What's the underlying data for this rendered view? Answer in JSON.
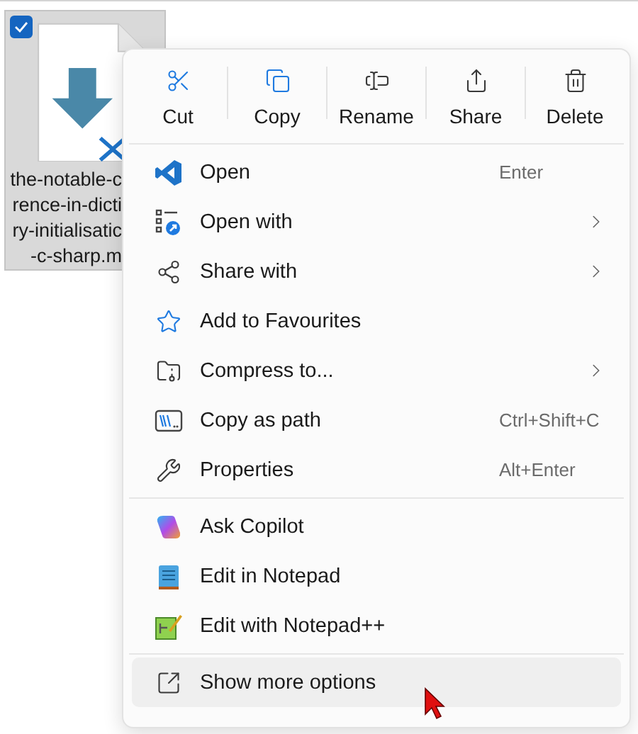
{
  "file": {
    "checked": true,
    "selected": true,
    "name_lines": [
      "the-notable-c",
      "rence-in-dicti",
      "ry-initialisatic",
      "-c-sharp.m"
    ]
  },
  "toolbar": [
    {
      "label": "Cut"
    },
    {
      "label": "Copy"
    },
    {
      "label": "Rename"
    },
    {
      "label": "Share"
    },
    {
      "label": "Delete"
    }
  ],
  "sections": [
    {
      "items": [
        {
          "label": "Open",
          "shortcut": "Enter",
          "submenu": false,
          "selected": false
        },
        {
          "label": "Open with",
          "submenu": true,
          "selected": false
        },
        {
          "label": "Share with",
          "submenu": true,
          "selected": false
        },
        {
          "label": "Add to Favourites",
          "submenu": false,
          "selected": false
        },
        {
          "label": "Compress to...",
          "submenu": true,
          "selected": false
        },
        {
          "label": "Copy as path",
          "shortcut": "Ctrl+Shift+C",
          "submenu": false,
          "selected": false
        },
        {
          "label": "Properties",
          "shortcut": "Alt+Enter",
          "submenu": false,
          "selected": false
        }
      ]
    },
    {
      "items": [
        {
          "label": "Ask Copilot",
          "submenu": false,
          "selected": false
        },
        {
          "label": "Edit in Notepad",
          "submenu": false,
          "selected": false
        },
        {
          "label": "Edit with Notepad++",
          "submenu": false,
          "selected": false
        }
      ]
    },
    {
      "items": [
        {
          "label": "Show more options",
          "submenu": false,
          "selected": true
        }
      ]
    }
  ]
}
